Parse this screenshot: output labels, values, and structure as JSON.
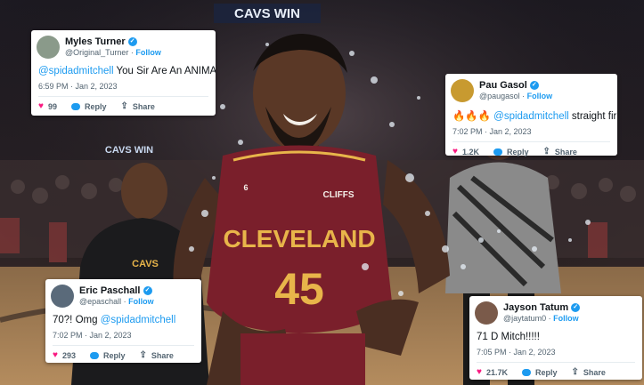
{
  "arena_sign": "CAVS WIN",
  "arena_sign_small": "CAVS WIN",
  "jersey": {
    "team": "CLEVELAND",
    "number": "45",
    "sponsor": "CLIFFS",
    "patch": "6"
  },
  "coach_shirt": "CAVS",
  "colors": {
    "jersey": "#7a1f2b",
    "jersey_gold": "#e8b54a",
    "tweet_blue": "#1d9bf0",
    "heart": "#f91880"
  },
  "tweets": [
    {
      "name": "Myles Turner",
      "handle": "@Original_Turner",
      "follow": "Follow",
      "mention": "@spidadmitchell",
      "text": " You Sir Are An ANIMAL",
      "prefix": "",
      "time": "6:59 PM · Jan 2, 2023",
      "likes": "99",
      "reply": "Reply",
      "share": "Share"
    },
    {
      "name": "Pau Gasol",
      "handle": "@paugasol",
      "follow": "Follow",
      "prefix": "🔥🔥🔥 ",
      "mention": "@spidadmitchell",
      "text": " straight fir",
      "time": "7:02 PM · Jan 2, 2023",
      "likes": "1.2K",
      "reply": "Reply",
      "share": "Share"
    },
    {
      "name": "Eric Paschall",
      "handle": "@epaschall",
      "follow": "Follow",
      "prefix": "70?! Omg ",
      "mention": "@spidadmitchell",
      "text": "",
      "time": "7:02 PM · Jan 2, 2023",
      "likes": "293",
      "reply": "Reply",
      "share": "Share"
    },
    {
      "name": "Jayson Tatum",
      "handle": "@jaytatum0",
      "follow": "Follow",
      "prefix": "71 D Mitch!!!!!",
      "mention": "",
      "text": "",
      "time": "7:05 PM · Jan 2, 2023",
      "likes": "21.7K",
      "reply": "Reply",
      "share": "Share"
    }
  ]
}
